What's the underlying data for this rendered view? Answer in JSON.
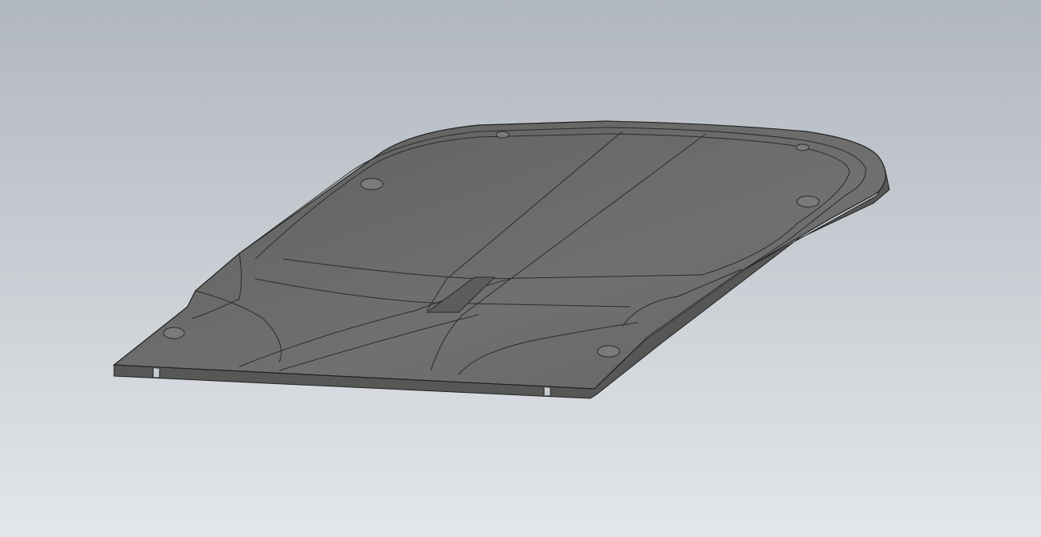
{
  "viewport": {
    "background_top": "#b1b7bf",
    "background_bottom": "#e3e7eb"
  },
  "model": {
    "face_color": "#6c6c6b",
    "edge_color": "#2a2a2a",
    "side_color": "#5a5a59"
  }
}
